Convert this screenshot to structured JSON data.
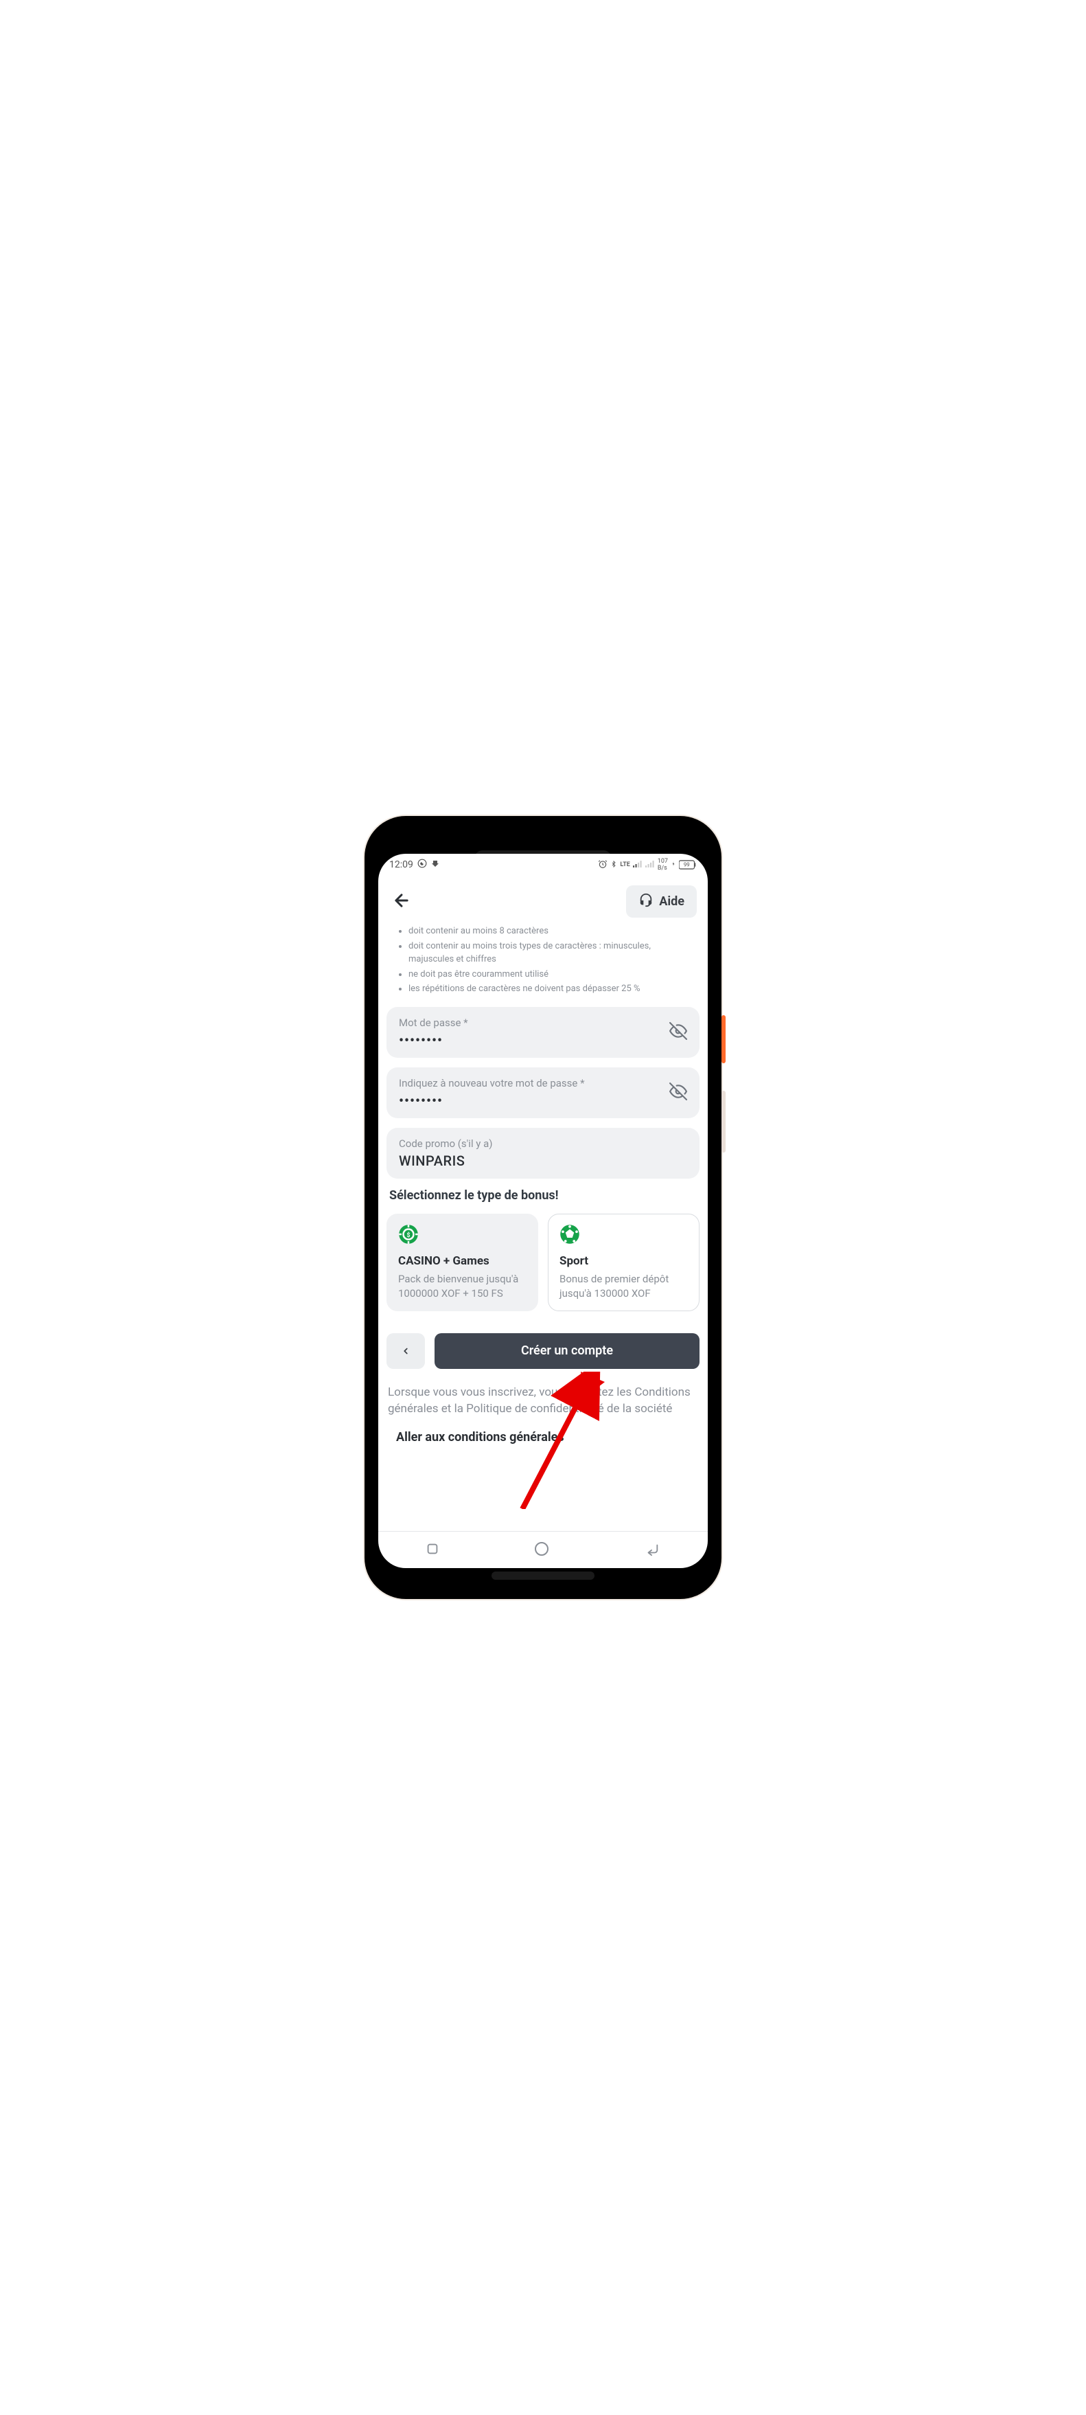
{
  "status": {
    "time": "12:09",
    "battery": "99"
  },
  "header": {
    "help_label": "Aide"
  },
  "rules": {
    "r1": "doit contenir au moins 8 caractères",
    "r2": "doit contenir au moins trois types de caractères : minuscules, majuscules et chiffres",
    "r3": "ne doit pas être couramment utilisé",
    "r4": "les répétitions de caractères ne doivent pas dépasser 25 %"
  },
  "fields": {
    "password": {
      "label": "Mot de passe *",
      "value": "••••••••"
    },
    "confirm": {
      "label": "Indiquez à nouveau votre mot de passe *",
      "value": "••••••••"
    },
    "promo": {
      "label": "Code promo (s'il y a)",
      "value": "WINPARIS"
    }
  },
  "bonus": {
    "section_title": "Sélectionnez le type de bonus!",
    "casino": {
      "icon": "chip-icon",
      "title": "CASINO + Games",
      "desc": "Pack de bienvenue jusqu'à 1000000 XOF + 150 FS"
    },
    "sport": {
      "icon": "ball-icon",
      "title": "Sport",
      "desc": "Bonus de premier dépôt jusqu'à 130000 XOF"
    }
  },
  "actions": {
    "create_label": "Créer un compte"
  },
  "legal": {
    "text": "Lorsque vous vous inscrivez, vous acceptez les Conditions générales et la Politique de confidentialité de la société",
    "terms_link": "Aller aux conditions générales"
  }
}
